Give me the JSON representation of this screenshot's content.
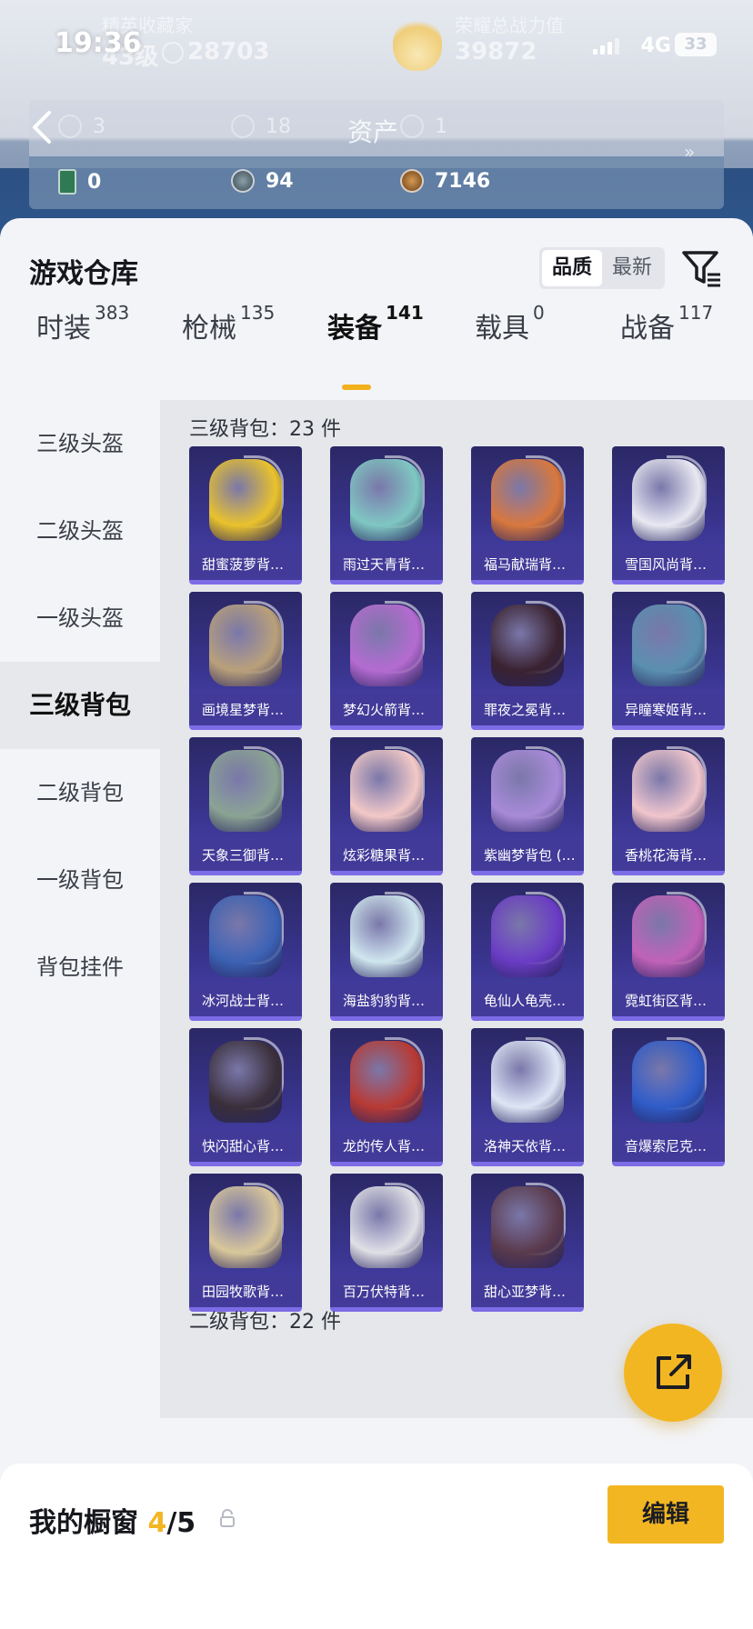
{
  "status_bar": {
    "time": "19:36",
    "network": "4G",
    "battery": "33"
  },
  "header": {
    "ghost_left_title": "精英收藏家",
    "ghost_level": "43级",
    "ghost_coins": "28703",
    "ghost_right_title": "荣耀总战力值",
    "ghost_power": "39872",
    "assets_title": "资产",
    "assets_top": [
      {
        "icon": "ticket-icon",
        "value": "3"
      },
      {
        "icon": "badge-icon",
        "value": "18"
      },
      {
        "icon": "coin-icon",
        "value": "1"
      }
    ],
    "assets_bottom": [
      {
        "icon": "card-icon",
        "value": "0"
      },
      {
        "icon": "orb-icon",
        "value": "94"
      },
      {
        "icon": "gold-coin-icon",
        "value": "7146"
      }
    ],
    "more_arrow": "»"
  },
  "sheet": {
    "title": "游戏仓库",
    "sort_options": [
      "品质",
      "最新"
    ],
    "sort_active": 0,
    "tabs": [
      {
        "label": "时装",
        "count": "383"
      },
      {
        "label": "枪械",
        "count": "135"
      },
      {
        "label": "装备",
        "count": "141"
      },
      {
        "label": "载具",
        "count": "0"
      },
      {
        "label": "战备",
        "count": "117"
      }
    ],
    "active_tab": 2,
    "sidebar": [
      "三级头盔",
      "二级头盔",
      "一级头盔",
      "三级背包",
      "二级背包",
      "一级背包",
      "背包挂件"
    ],
    "active_sidebar": 3,
    "section_1": "三级背包：23 件",
    "section_2": "二级背包：22 件",
    "items": [
      {
        "name": "甜蜜菠萝背…",
        "color": "#e9c22c"
      },
      {
        "name": "雨过天青背…",
        "color": "#7fc7c2"
      },
      {
        "name": "福马献瑞背…",
        "color": "#d8783e"
      },
      {
        "name": "雪国风尚背…",
        "color": "#e8e8f2"
      },
      {
        "name": "画境星梦背…",
        "color": "#b9a07a"
      },
      {
        "name": "梦幻火箭背…",
        "color": "#b46bd0"
      },
      {
        "name": "罪夜之冕背…",
        "color": "#3a2230"
      },
      {
        "name": "异瞳寒姬背…",
        "color": "#5a8fb0"
      },
      {
        "name": "天象三御背…",
        "color": "#8aa393"
      },
      {
        "name": "炫彩糖果背…",
        "color": "#f2c9c7"
      },
      {
        "name": "紫幽梦背包 (…",
        "color": "#a88ad8"
      },
      {
        "name": "香桃花海背…",
        "color": "#f0c6cc"
      },
      {
        "name": "冰河战士背…",
        "color": "#3c62b4"
      },
      {
        "name": "海盐豹豹背…",
        "color": "#cfe6ee"
      },
      {
        "name": "龟仙人龟壳…",
        "color": "#6a3cc4"
      },
      {
        "name": "霓虹街区背…",
        "color": "#c062b8"
      },
      {
        "name": "快闪甜心背…",
        "color": "#3a2f3a"
      },
      {
        "name": "龙的传人背…",
        "color": "#b83a34"
      },
      {
        "name": "洛神天依背…",
        "color": "#dde6f5"
      },
      {
        "name": "音爆索尼克…",
        "color": "#2f5cc8"
      },
      {
        "name": "田园牧歌背…",
        "color": "#d9c79a"
      },
      {
        "name": "百万伏特背…",
        "color": "#e0e0e6"
      },
      {
        "name": "甜心亚梦背…",
        "color": "#5a3a4c"
      }
    ]
  },
  "bottom_bar": {
    "label": "我的橱窗",
    "count_current": "4",
    "count_total": "/5",
    "edit_label": "编辑"
  }
}
